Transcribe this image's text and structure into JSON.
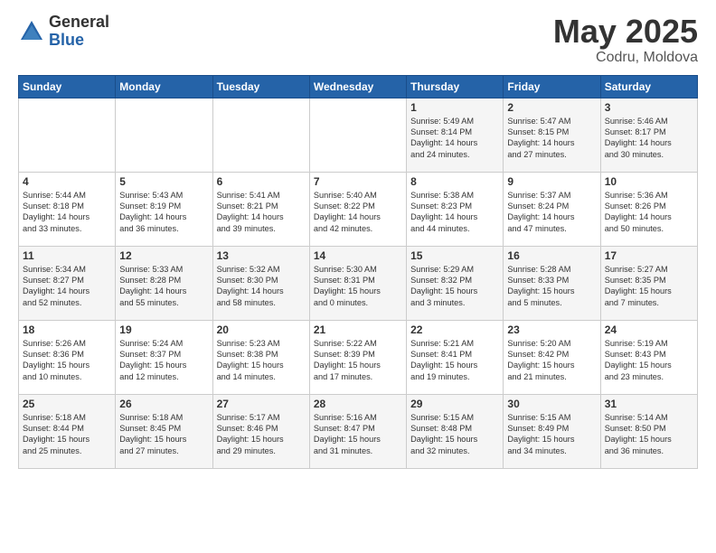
{
  "logo": {
    "general": "General",
    "blue": "Blue"
  },
  "title": "May 2025",
  "location": "Codru, Moldova",
  "headers": [
    "Sunday",
    "Monday",
    "Tuesday",
    "Wednesday",
    "Thursday",
    "Friday",
    "Saturday"
  ],
  "weeks": [
    [
      {
        "day": "",
        "info": ""
      },
      {
        "day": "",
        "info": ""
      },
      {
        "day": "",
        "info": ""
      },
      {
        "day": "",
        "info": ""
      },
      {
        "day": "1",
        "info": "Sunrise: 5:49 AM\nSunset: 8:14 PM\nDaylight: 14 hours\nand 24 minutes."
      },
      {
        "day": "2",
        "info": "Sunrise: 5:47 AM\nSunset: 8:15 PM\nDaylight: 14 hours\nand 27 minutes."
      },
      {
        "day": "3",
        "info": "Sunrise: 5:46 AM\nSunset: 8:17 PM\nDaylight: 14 hours\nand 30 minutes."
      }
    ],
    [
      {
        "day": "4",
        "info": "Sunrise: 5:44 AM\nSunset: 8:18 PM\nDaylight: 14 hours\nand 33 minutes."
      },
      {
        "day": "5",
        "info": "Sunrise: 5:43 AM\nSunset: 8:19 PM\nDaylight: 14 hours\nand 36 minutes."
      },
      {
        "day": "6",
        "info": "Sunrise: 5:41 AM\nSunset: 8:21 PM\nDaylight: 14 hours\nand 39 minutes."
      },
      {
        "day": "7",
        "info": "Sunrise: 5:40 AM\nSunset: 8:22 PM\nDaylight: 14 hours\nand 42 minutes."
      },
      {
        "day": "8",
        "info": "Sunrise: 5:38 AM\nSunset: 8:23 PM\nDaylight: 14 hours\nand 44 minutes."
      },
      {
        "day": "9",
        "info": "Sunrise: 5:37 AM\nSunset: 8:24 PM\nDaylight: 14 hours\nand 47 minutes."
      },
      {
        "day": "10",
        "info": "Sunrise: 5:36 AM\nSunset: 8:26 PM\nDaylight: 14 hours\nand 50 minutes."
      }
    ],
    [
      {
        "day": "11",
        "info": "Sunrise: 5:34 AM\nSunset: 8:27 PM\nDaylight: 14 hours\nand 52 minutes."
      },
      {
        "day": "12",
        "info": "Sunrise: 5:33 AM\nSunset: 8:28 PM\nDaylight: 14 hours\nand 55 minutes."
      },
      {
        "day": "13",
        "info": "Sunrise: 5:32 AM\nSunset: 8:30 PM\nDaylight: 14 hours\nand 58 minutes."
      },
      {
        "day": "14",
        "info": "Sunrise: 5:30 AM\nSunset: 8:31 PM\nDaylight: 15 hours\nand 0 minutes."
      },
      {
        "day": "15",
        "info": "Sunrise: 5:29 AM\nSunset: 8:32 PM\nDaylight: 15 hours\nand 3 minutes."
      },
      {
        "day": "16",
        "info": "Sunrise: 5:28 AM\nSunset: 8:33 PM\nDaylight: 15 hours\nand 5 minutes."
      },
      {
        "day": "17",
        "info": "Sunrise: 5:27 AM\nSunset: 8:35 PM\nDaylight: 15 hours\nand 7 minutes."
      }
    ],
    [
      {
        "day": "18",
        "info": "Sunrise: 5:26 AM\nSunset: 8:36 PM\nDaylight: 15 hours\nand 10 minutes."
      },
      {
        "day": "19",
        "info": "Sunrise: 5:24 AM\nSunset: 8:37 PM\nDaylight: 15 hours\nand 12 minutes."
      },
      {
        "day": "20",
        "info": "Sunrise: 5:23 AM\nSunset: 8:38 PM\nDaylight: 15 hours\nand 14 minutes."
      },
      {
        "day": "21",
        "info": "Sunrise: 5:22 AM\nSunset: 8:39 PM\nDaylight: 15 hours\nand 17 minutes."
      },
      {
        "day": "22",
        "info": "Sunrise: 5:21 AM\nSunset: 8:41 PM\nDaylight: 15 hours\nand 19 minutes."
      },
      {
        "day": "23",
        "info": "Sunrise: 5:20 AM\nSunset: 8:42 PM\nDaylight: 15 hours\nand 21 minutes."
      },
      {
        "day": "24",
        "info": "Sunrise: 5:19 AM\nSunset: 8:43 PM\nDaylight: 15 hours\nand 23 minutes."
      }
    ],
    [
      {
        "day": "25",
        "info": "Sunrise: 5:18 AM\nSunset: 8:44 PM\nDaylight: 15 hours\nand 25 minutes."
      },
      {
        "day": "26",
        "info": "Sunrise: 5:18 AM\nSunset: 8:45 PM\nDaylight: 15 hours\nand 27 minutes."
      },
      {
        "day": "27",
        "info": "Sunrise: 5:17 AM\nSunset: 8:46 PM\nDaylight: 15 hours\nand 29 minutes."
      },
      {
        "day": "28",
        "info": "Sunrise: 5:16 AM\nSunset: 8:47 PM\nDaylight: 15 hours\nand 31 minutes."
      },
      {
        "day": "29",
        "info": "Sunrise: 5:15 AM\nSunset: 8:48 PM\nDaylight: 15 hours\nand 32 minutes."
      },
      {
        "day": "30",
        "info": "Sunrise: 5:15 AM\nSunset: 8:49 PM\nDaylight: 15 hours\nand 34 minutes."
      },
      {
        "day": "31",
        "info": "Sunrise: 5:14 AM\nSunset: 8:50 PM\nDaylight: 15 hours\nand 36 minutes."
      }
    ]
  ]
}
